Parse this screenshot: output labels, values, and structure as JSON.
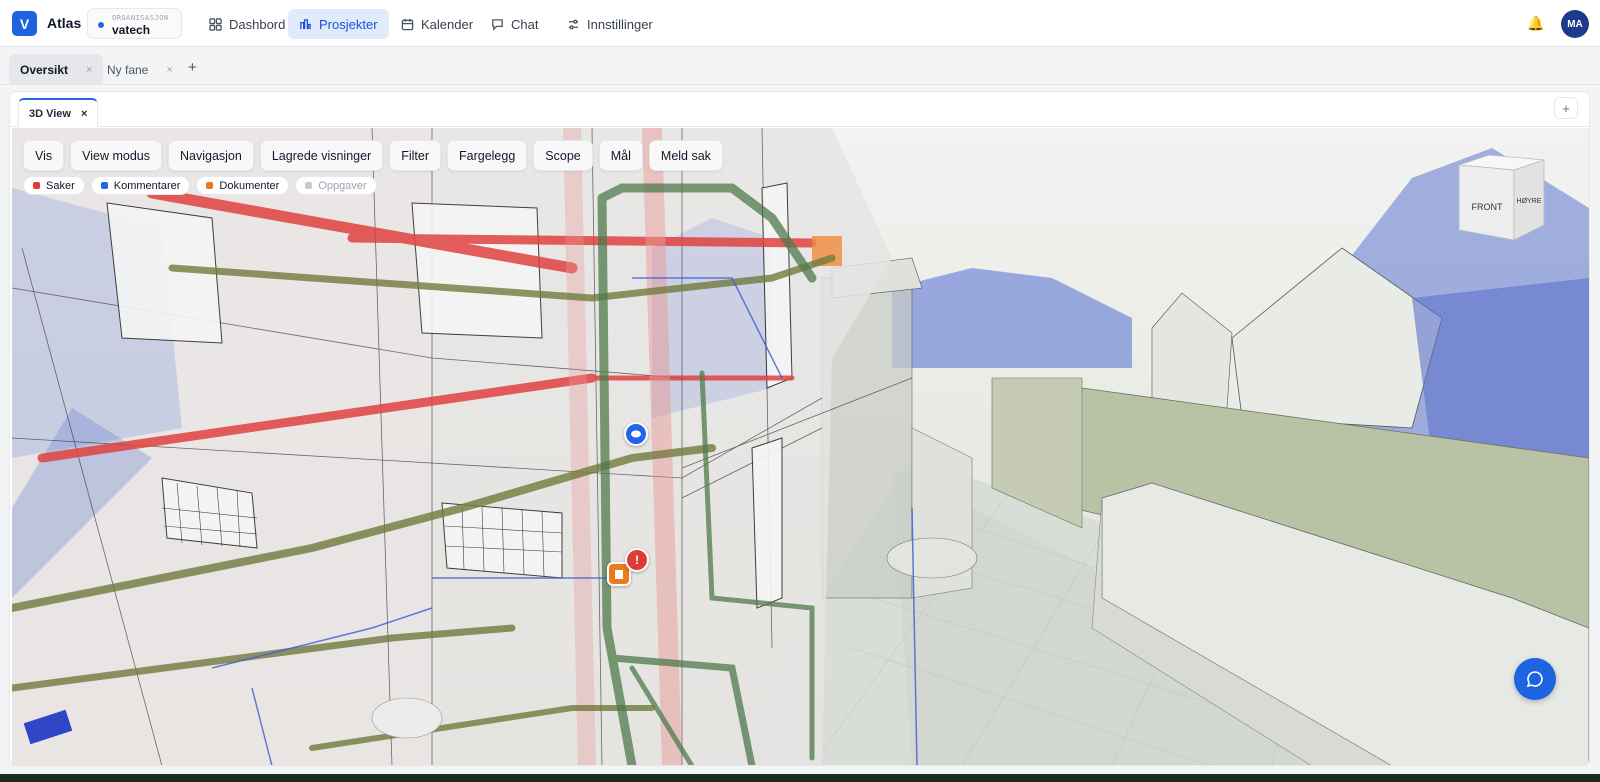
{
  "app": {
    "logo_letter": "V",
    "name": "Atlas"
  },
  "org": {
    "label": "ORGANISASJON",
    "name": "vatech"
  },
  "nav": [
    {
      "label": "Dashbord",
      "icon": "dashboard-icon"
    },
    {
      "label": "Prosjekter",
      "icon": "projects-icon",
      "active": true
    },
    {
      "label": "Kalender",
      "icon": "calendar-icon"
    },
    {
      "label": "Chat",
      "icon": "chat-icon"
    },
    {
      "label": "Innstillinger",
      "icon": "settings-icon"
    }
  ],
  "user": {
    "initials": "MA"
  },
  "workspace_tabs": [
    {
      "label": "Oversikt",
      "close": "×",
      "active": true
    },
    {
      "label": "Ny fane",
      "close": "×"
    }
  ],
  "add_tab": "+",
  "panel": {
    "tab_label": "3D View",
    "tab_close": "×",
    "add": "+"
  },
  "toolbar": [
    "Vis",
    "View modus",
    "Navigasjon",
    "Lagrede visninger",
    "Filter",
    "Fargelegg",
    "Scope",
    "Mål",
    "Meld sak"
  ],
  "filters": [
    {
      "label": "Saker",
      "color": "#e03b3b",
      "on": true
    },
    {
      "label": "Kommentarer",
      "color": "#2563eb",
      "on": true
    },
    {
      "label": "Dokumenter",
      "color": "#ea7a1c",
      "on": true
    },
    {
      "label": "Oppgaver",
      "color": "#c9c9c9",
      "on": false
    }
  ],
  "view_cube": {
    "front": "FRONT",
    "right": "HØYRE"
  },
  "markers": [
    {
      "type": "comment",
      "color": "#2563eb"
    },
    {
      "type": "issue",
      "color": "#e03b3b",
      "symbol": "!"
    },
    {
      "type": "document",
      "color": "#ea7a1c"
    }
  ],
  "colors": {
    "accent": "#1d64e0",
    "active_nav_bg": "#e0ecfb"
  }
}
